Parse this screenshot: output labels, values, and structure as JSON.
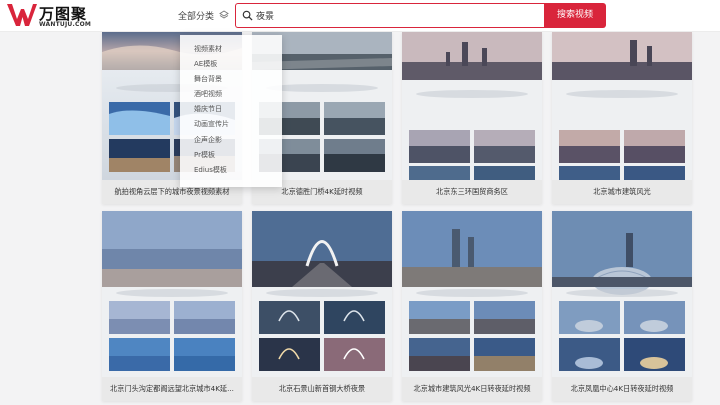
{
  "header": {
    "logo_text": "万图聚",
    "logo_url": "WANTUJU.COM",
    "category_label": "全部分类",
    "search": {
      "value": "夜景",
      "button_label": "搜索视频"
    }
  },
  "dropdown": {
    "items": [
      "视频素材",
      "AE模板",
      "舞台背景",
      "酒吧视频",
      "婚庆节日",
      "动画宣传片",
      "企声企影",
      "Pr模板",
      "Edius模板"
    ]
  },
  "cards": [
    {
      "title": "航拍视角云层下的城市夜景视频素材",
      "theme": "dusk-clouds"
    },
    {
      "title": "北京德胜门桥4K延时视频",
      "theme": "day-road"
    },
    {
      "title": "北京东三环国贸商务区",
      "theme": "dusk-city"
    },
    {
      "title": "北京城市建筑风光",
      "theme": "dusk-city"
    },
    {
      "title": "北京门头沟定都阁远望北京城市4K延...",
      "theme": "blue-city"
    },
    {
      "title": "北京石景山新首钢大桥夜景",
      "theme": "bridge"
    },
    {
      "title": "北京城市建筑风光4K日转夜延时视频",
      "theme": "blue-city"
    },
    {
      "title": "北京凤凰中心4K日转夜延时视频",
      "theme": "dome"
    }
  ],
  "colors": {
    "brand": "#d9253b"
  }
}
